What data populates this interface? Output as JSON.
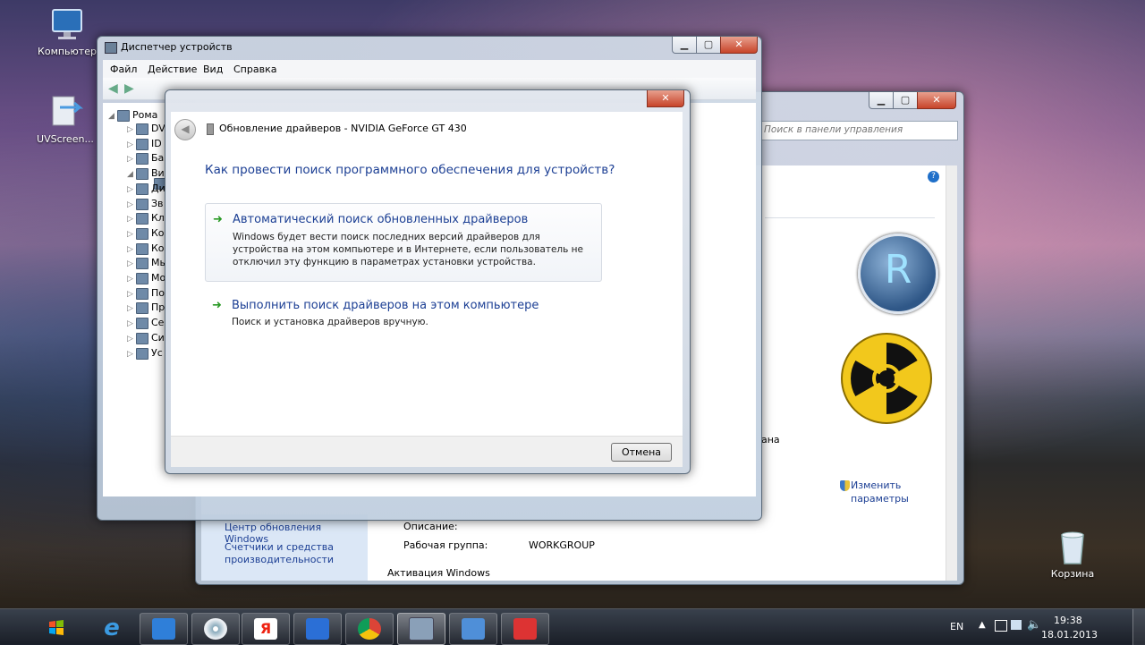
{
  "desktop": {
    "icons": [
      {
        "label": "Компьютер"
      },
      {
        "label": "UVScreen..."
      },
      {
        "label": "Корзина"
      }
    ]
  },
  "device_manager": {
    "title": "Диспетчер устройств",
    "menu": [
      "Файл",
      "Действие",
      "Вид",
      "Справка"
    ],
    "tree_root": "Рома",
    "tree_items": [
      "DV",
      "ID",
      "Ба",
      "Ви",
      "Ди",
      "Зв",
      "Кл",
      "Ко",
      "Ко",
      "Мь",
      "Мо",
      "По",
      "Пр",
      "Се",
      "Си",
      "Ус"
    ]
  },
  "control_panel": {
    "search_placeholder": "Поиск в панели управления",
    "sidebar_links": [
      "Центр обновления Windows",
      "Счетчики и средства производительности"
    ],
    "change_params": "Изменить параметры",
    "partial_text": "ана",
    "description_label": "Описание:",
    "workgroup_label": "Рабочая группа:",
    "workgroup_value": "WORKGROUP",
    "activation_label": "Активация Windows",
    "logo_letter": "R"
  },
  "driver_dialog": {
    "title": "Обновление драйверов - NVIDIA GeForce GT 430",
    "question": "Как провести поиск программного обеспечения для устройств?",
    "options": [
      {
        "title": "Автоматический поиск обновленных драйверов",
        "desc": "Windows будет вести поиск последних версий драйверов для устройства на этом компьютере и в Интернете, если пользователь не отключил эту функцию в параметрах установки устройства."
      },
      {
        "title": "Выполнить поиск драйверов на этом компьютере",
        "desc": "Поиск и установка драйверов вручную."
      }
    ],
    "cancel": "Отмена"
  },
  "taskbar": {
    "lang": "EN",
    "time": "19:38",
    "date": "18.01.2013",
    "apps": [
      "internet-explorer",
      "explorer",
      "media",
      "yandex",
      "mail",
      "chrome",
      "device-manager",
      "network",
      "toolbox"
    ]
  },
  "colors": {
    "link": "#1c3f94",
    "green_arrow": "#2b9a26",
    "radiation_yellow": "#f2c81c"
  }
}
